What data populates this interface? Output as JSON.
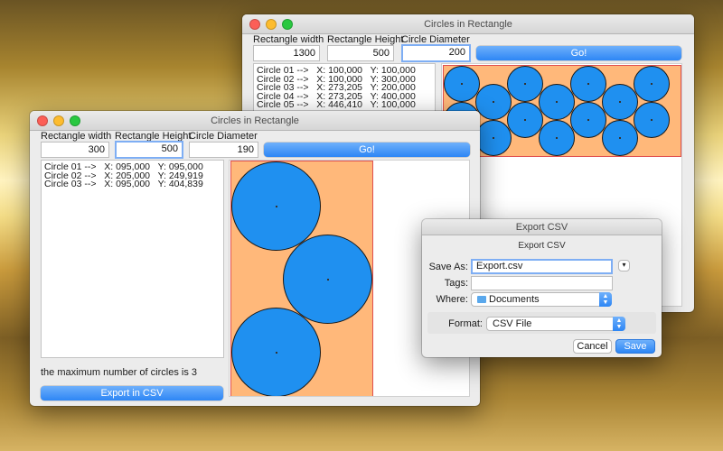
{
  "back_window": {
    "title": "Circles in Rectangle",
    "labels": {
      "width": "Rectangle width",
      "height": "Rectangle Height",
      "diameter": "Circle Diameter"
    },
    "values": {
      "width": "1300",
      "height": "500",
      "diameter": "200"
    },
    "go_label": "Go!",
    "list": [
      "Circle 01 -->   X: 100,000   Y: 100,000",
      "Circle 02 -->   X: 100,000   Y: 300,000",
      "Circle 03 -->   X: 273,205   Y: 200,000",
      "Circle 04 -->   X: 273,205   Y: 400,000",
      "Circle 05 -->   X: 446,410   Y: 100,000"
    ]
  },
  "front_window": {
    "title": "Circles in Rectangle",
    "labels": {
      "width": "Rectangle width",
      "height": "Rectangle Height",
      "diameter": "Circle Diameter"
    },
    "values": {
      "width": "300",
      "height": "500",
      "diameter": "190"
    },
    "go_label": "Go!",
    "list": [
      "Circle 01 -->   X: 095,000   Y: 095,000",
      "Circle 02 -->   X: 205,000   Y: 249,919",
      "Circle 03 -->   X: 095,000   Y: 404,839"
    ],
    "status_text": "the maximum number of circles is 3",
    "export_label": "Export in CSV"
  },
  "export_dialog": {
    "title": "Export CSV",
    "subtitle": "Export CSV",
    "save_as_label": "Save As:",
    "save_as_value": "Export.csv",
    "tags_label": "Tags:",
    "tags_value": "",
    "where_label": "Where:",
    "where_value": "Documents",
    "format_label": "Format:",
    "format_value": "CSV File",
    "cancel_label": "Cancel",
    "save_label": "Save"
  },
  "colors": {
    "circle_fill": "#1f90f0",
    "rect_fill": "#ffb87a",
    "rect_border": "#e05050",
    "accent": "#2d86f5"
  }
}
